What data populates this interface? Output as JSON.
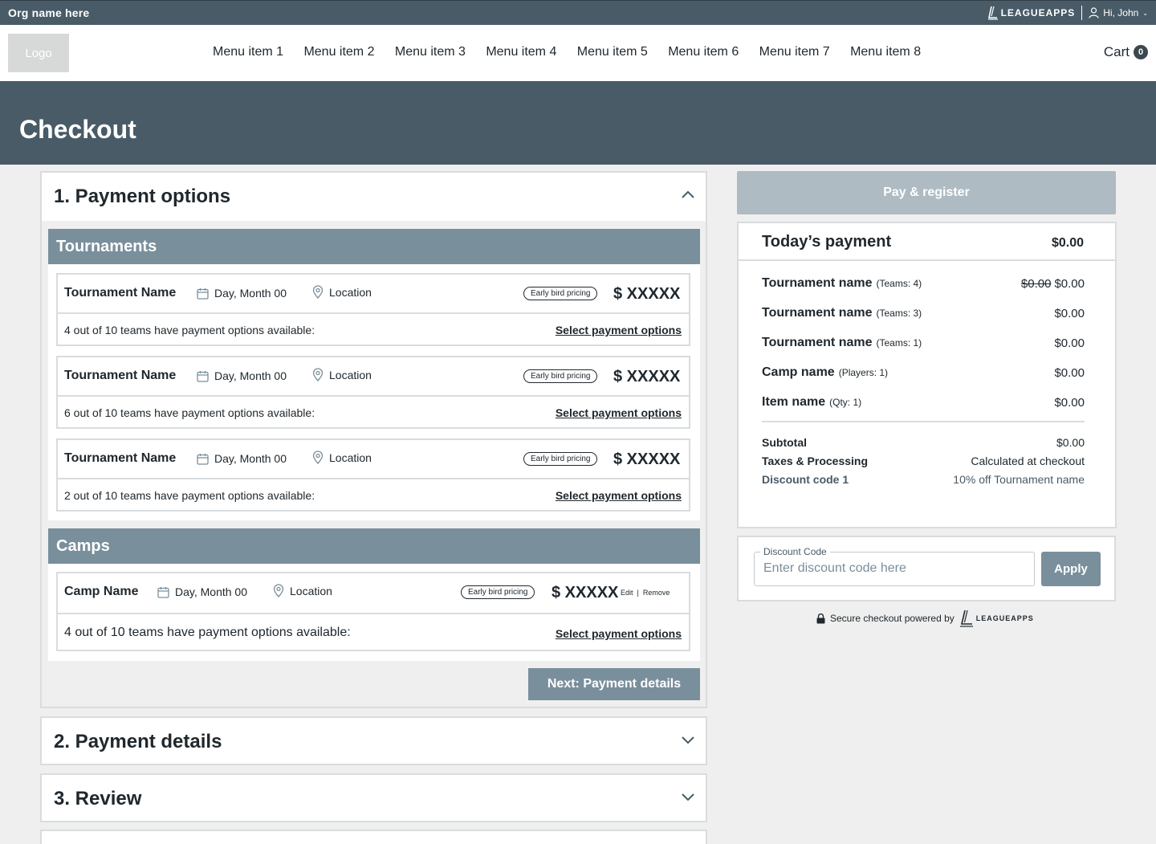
{
  "topbar": {
    "org_name": "Org name here",
    "brand": "LEAGUEAPPS",
    "greeting": "Hi, John"
  },
  "nav": {
    "logo": "Logo",
    "items": [
      "Menu item 1",
      "Menu item 2",
      "Menu item 3",
      "Menu item 4",
      "Menu item 5",
      "Menu item 6",
      "Menu item 7",
      "Menu item 8"
    ],
    "cart_label": "Cart",
    "cart_count": "0"
  },
  "hero": {
    "title": "Checkout"
  },
  "step1": {
    "title": "1. Payment options",
    "tournaments": {
      "header": "Tournaments",
      "cards": [
        {
          "name": "Tournament Name",
          "date": "Day, Month 00",
          "location": "Location",
          "badge": "Early bird pricing",
          "price": "$ XXXXX",
          "availability": "4 out of 10 teams have payment options available:",
          "link": "Select payment options"
        },
        {
          "name": "Tournament Name",
          "date": "Day, Month 00",
          "location": "Location",
          "badge": "Early bird pricing",
          "price": "$ XXXXX",
          "availability": "6 out of 10 teams have payment options available:",
          "link": "Select payment options"
        },
        {
          "name": "Tournament Name",
          "date": "Day, Month 00",
          "location": "Location",
          "badge": "Early bird pricing",
          "price": "$ XXXXX",
          "availability": "2 out of 10 teams have payment options available:",
          "link": "Select payment options"
        }
      ]
    },
    "camps": {
      "header": "Camps",
      "card": {
        "name": "Camp Name",
        "date": "Day, Month 00",
        "location": "Location",
        "badge": "Early bird pricing",
        "price": "$ XXXXX",
        "edit": "Edit",
        "remove": "Remove",
        "availability": "4 out of 10 teams have payment options available:",
        "link": "Select payment options"
      }
    },
    "next_button": "Next: Payment details"
  },
  "step2": {
    "title": "2. Payment details"
  },
  "step3": {
    "title": "3. Review"
  },
  "summary": {
    "pay_button": "Pay & register",
    "title": "Today’s payment",
    "total": "$0.00",
    "lines": [
      {
        "name": "Tournament name",
        "qty": "(Teams: 4)",
        "old_price": "$0.00",
        "price": "$0.00"
      },
      {
        "name": "Tournament name",
        "qty": "(Teams: 3)",
        "price": "$0.00"
      },
      {
        "name": "Tournament name",
        "qty": "(Teams: 1)",
        "price": "$0.00"
      },
      {
        "name": "Camp name",
        "qty": "(Players: 1)",
        "price": "$0.00"
      },
      {
        "name": "Item name",
        "qty": "(Qty: 1)",
        "price": "$0.00"
      }
    ],
    "subtotal_label": "Subtotal",
    "subtotal_value": "$0.00",
    "taxes_label": "Taxes & Processing",
    "taxes_value": "Calculated at checkout",
    "discount_label": "Discount code 1",
    "discount_value": "10% off Tournament name"
  },
  "discount": {
    "label": "Discount Code",
    "placeholder": "Enter discount code here",
    "apply": "Apply"
  },
  "secure": {
    "text": "Secure checkout powered by",
    "brand": "LEAGUEAPPS"
  }
}
